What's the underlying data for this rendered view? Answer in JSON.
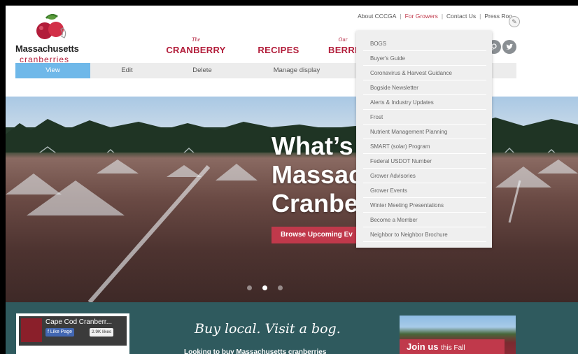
{
  "brand": {
    "name": "Massachusetts",
    "sub": "cranberries"
  },
  "util_nav": {
    "items": [
      "About CCCGA",
      "For Growers",
      "Contact Us",
      "Press Roo"
    ],
    "separator": "|",
    "active_color": "#c0394b"
  },
  "main_nav": [
    {
      "pre": "The",
      "label": "CRANBERRY"
    },
    {
      "pre": "",
      "label": "RECIPES"
    },
    {
      "pre": "Our",
      "label": "BERRI"
    }
  ],
  "admin_tabs": [
    "View",
    "Edit",
    "Delete",
    "Manage display"
  ],
  "dropdown": {
    "items": [
      "BOGS",
      "Buyer's Guide",
      "Coronavirus & Harvest Guidance",
      "Bogside Newsletter",
      "Alerts & Industry Updates",
      "Frost",
      "Nutrient Management Planning",
      "SMART (solar) Program",
      "Federal USDOT Number",
      "Grower Advisories",
      "Grower Events",
      "Winter Meeting Presentations",
      "Become a Member",
      "Neighbor to Neighbor Brochure"
    ]
  },
  "hero": {
    "title": "What’s\nMassac\nCranbe",
    "button": "Browse Upcoming Ev"
  },
  "band": {
    "heading": "Buy local. Visit a bog.",
    "text": "Looking to buy Massachusetts cranberries"
  },
  "facebook": {
    "title": "Cape Cod Cranberr...",
    "like_label": "Like Page",
    "count": "2.9K likes"
  },
  "promo": {
    "lead": "Join us",
    "rest": "this Fall"
  },
  "icons": [
    "pinterest-icon",
    "twitter-icon",
    "pencil-icon",
    "facebook-icon"
  ],
  "colors": {
    "brand_red": "#b21d3a",
    "tab_active": "#6fb8e9",
    "band": "#2f5a5e"
  }
}
